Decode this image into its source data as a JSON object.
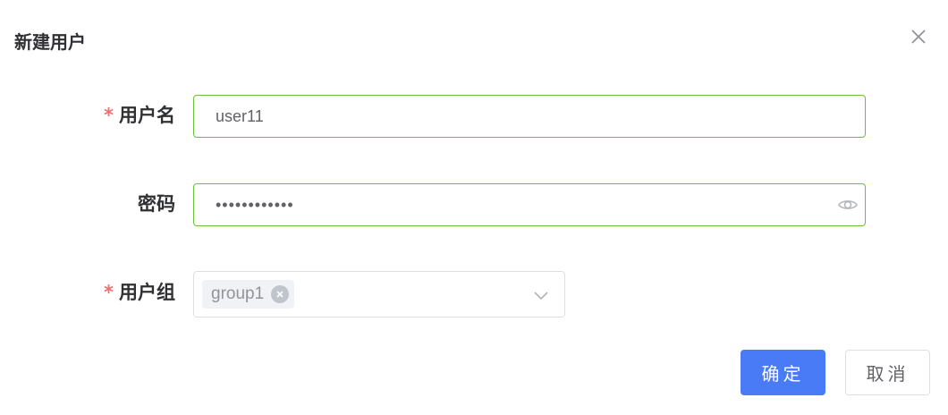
{
  "dialog": {
    "title": "新建用户"
  },
  "form": {
    "username": {
      "required_mark": "*",
      "label": "用户名",
      "value": "user11"
    },
    "password": {
      "label": "密码",
      "value": "••••••••••••"
    },
    "user_group": {
      "required_mark": "*",
      "label": "用户组",
      "selected_tags": [
        "group1"
      ]
    }
  },
  "actions": {
    "confirm_label": "确定",
    "cancel_label": "取消"
  },
  "colors": {
    "primary": "#4a7bf7",
    "required": "#f56c6c",
    "valid_border": "#67c23a"
  },
  "icons": {
    "close": "close-icon",
    "password_visibility": "eye-icon",
    "tag_remove": "circle-x-icon",
    "dropdown": "chevron-down-icon"
  }
}
